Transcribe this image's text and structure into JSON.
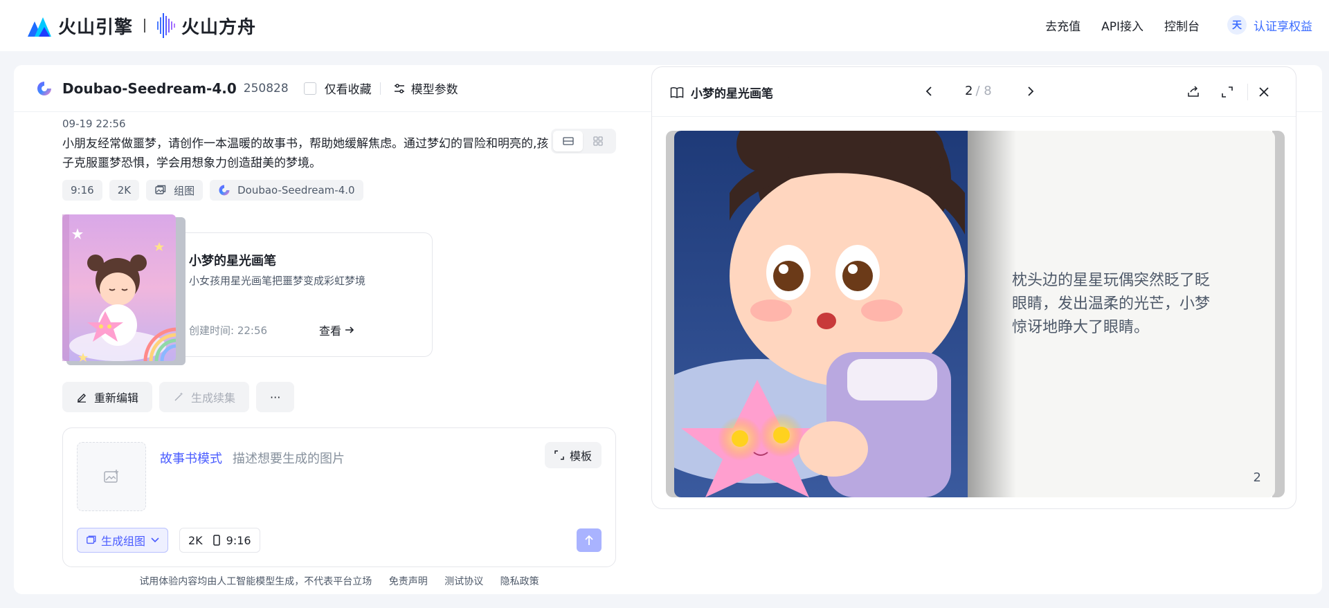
{
  "header": {
    "brand_primary": "火山引擎",
    "brand_secondary": "火山方舟",
    "nav": [
      "去充值",
      "API接入",
      "控制台"
    ],
    "avatar_char": "天",
    "cert_label": "认证享权益"
  },
  "model_bar": {
    "name": "Doubao-Seedream-4.0",
    "version": "250828",
    "favorites_label": "仅看收藏",
    "params_label": "模型参数"
  },
  "message": {
    "time": "09-19 22:56",
    "prompt": "小朋友经常做噩梦，请创作一本温暖的故事书，帮助她缓解焦虑。通过梦幻的冒险和明亮的,孩子克服噩梦恐惧，学会用想象力创造甜美的梦境。",
    "tags": {
      "ratio": "9:16",
      "resolution": "2K",
      "mode": "组图",
      "model": "Doubao-Seedream-4.0"
    }
  },
  "story_card": {
    "title": "小梦的星光画笔",
    "desc": "小女孩用星光画笔把噩梦变成彩虹梦境",
    "created": "创建时间: 22:56",
    "view_label": "查看"
  },
  "actions": {
    "reedit": "重新编辑",
    "continue": "生成续集",
    "more": "···"
  },
  "composer": {
    "mode_label": "故事书模式",
    "placeholder": "描述想要生成的图片",
    "template_label": "模板",
    "gen_mode_label": "生成组图",
    "resolution": "2K",
    "ratio": "9:16"
  },
  "footer": {
    "notice": "试用体验内容均由人工智能模型生成，不代表平台立场",
    "links": [
      "免责声明",
      "测试协议",
      "隐私政策"
    ]
  },
  "reader": {
    "title": "小梦的星光画笔",
    "page_current": "2",
    "page_total": "/ 8",
    "page_text": "枕头边的星星玩偶突然眨了眨眼睛，发出温柔的光芒，小梦惊讶地睁大了眼睛。",
    "page_number": "2"
  },
  "colors": {
    "accent": "#4a5cff",
    "brand_blue": "#3b6cff"
  }
}
